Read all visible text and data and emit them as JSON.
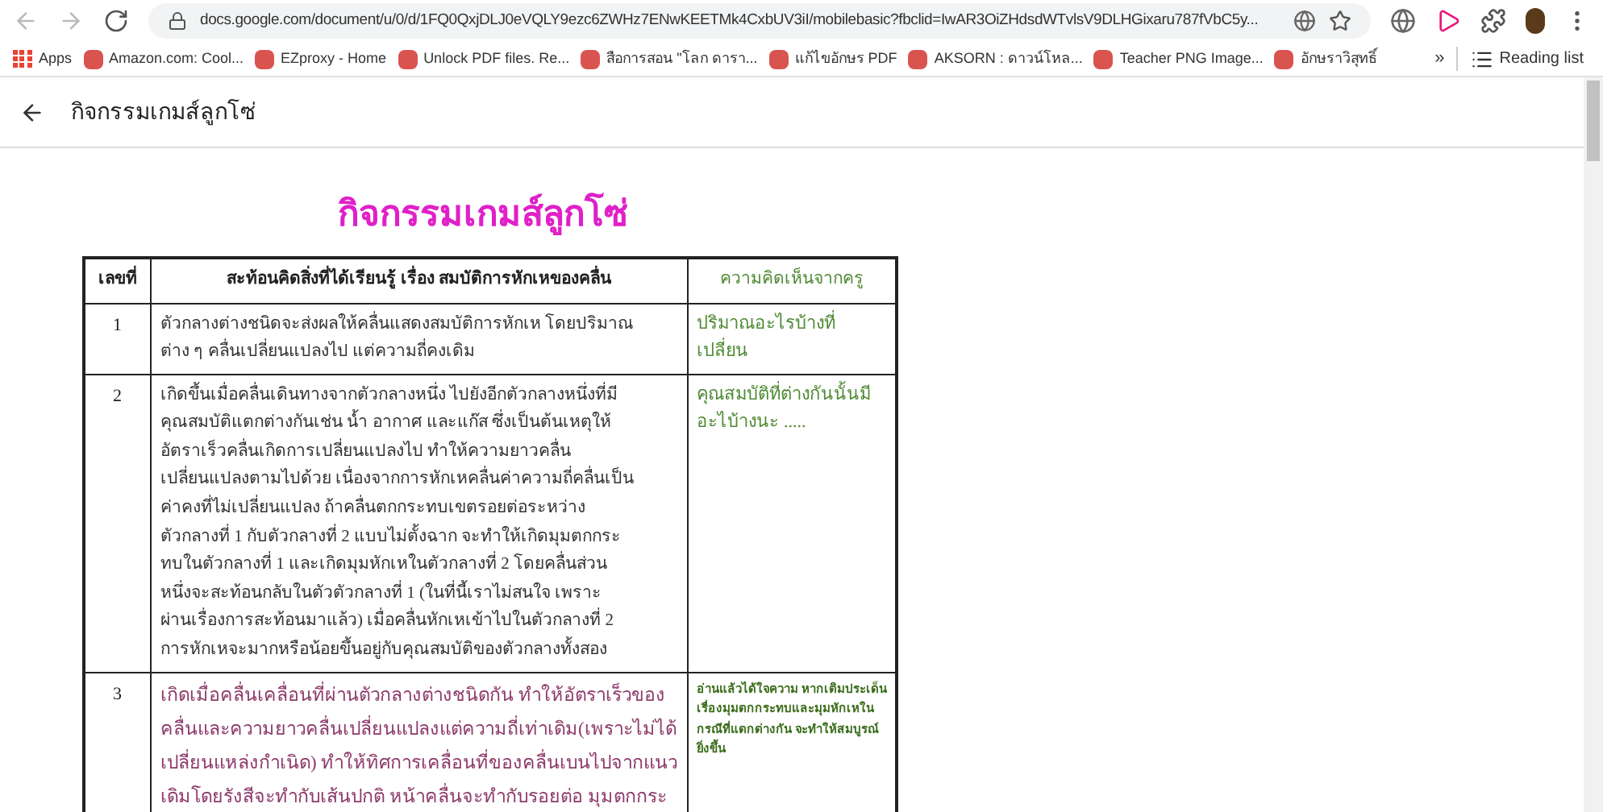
{
  "browser": {
    "url": "docs.google.com/document/u/0/d/1FQ0QxjDLJ0eVQLY9ezc6ZWHz7ENwKEETMk4CxbUV3iI/mobilebasic?fbclid=IwAR3OiZHdsdWTvlsV9DLHGixaru787fVbC5y...",
    "bookmarks": [
      "Apps",
      "Amazon.com: Cool...",
      "EZproxy - Home",
      "Unlock PDF files. Re...",
      "สือการสอน \"โลก ดารา...",
      "แก้ไขอักษร PDF",
      "AKSORN : ดาวน์โหล...",
      "Teacher PNG Image...",
      "อักษราวิสุทธิ์"
    ],
    "overflow": "»",
    "reading_list": "Reading list"
  },
  "doc_header": {
    "title": "กิจกรรมเกมส์ลูกโซ่"
  },
  "document": {
    "heading": "กิจกรรมเกมส์ลูกโซ่",
    "table": {
      "columns": [
        "เลขที่",
        "สะท้อนคิดสิ่งที่ได้เรียนรู้  เรื่อง สมบัติการหักเหของคลื่น",
        "ความคิดเห็นจากครู"
      ],
      "rows": [
        {
          "number": "1",
          "kind": "plain",
          "lines": [
            "ตัวกลางต่างชนิดจะส่งผลให้คลื่นแสดงสมบัติการหักเห โดยปริมาณ",
            "ต่าง ๆ คลื่นเปลี่ยนแปลงไป แต่ความถี่คงเดิม"
          ],
          "comment": {
            "kind": "normal",
            "lines": [
              "ปริมาณอะไรบ้างที่",
              "เปลี่ยน"
            ]
          }
        },
        {
          "number": "2",
          "kind": "plain",
          "lines": [
            "เกิดขึ้นเมื่อคลื่นเดินทางจากตัวกลางหนึ่ง ไปยังอีกตัวกลางหนึ่งที่มี",
            "คุณสมบัติแตกต่างกันเช่น น้ำ อากาศ และแก๊ส ซึ่งเป็นต้นเหตุให้",
            "อัตราเร็วคลื่นเกิดการเปลี่ยนแปลงไป ทำให้ความยาวคลื่น",
            "เปลี่ยนแปลงตามไปด้วย เนื่องจากการหักเหคลื่นค่าความถี่คลื่นเป็น",
            "ค่าคงที่ไม่เปลี่ยนแปลง  ถ้าคลื่นตกกระทบเขตรอยต่อระหว่าง",
            "ตัวกลางที่ 1 กับตัวกลางที่ 2  แบบไม่ตั้งฉาก จะทำให้เกิดมุมตกกระ",
            "ทบในตัวกลางที่ 1 และเกิดมุมหักเหในตัวกลางที่ 2 โดยคลื่นส่วน",
            "หนึ่งจะสะท้อนกลับในตัวตัวกลางที่ 1 (ในที่นี้เราไม่สนใจ เพราะ",
            "ผ่านเรื่องการสะท้อนมาแล้ว)  เมื่อคลื่นหักเหเข้าไปในตัวกลางที่ 2",
            " การหักเหจะมากหรือน้อยขึ้นอยู่กับคุณสมบัติของตัวกลางทั้งสอง"
          ],
          "comment": {
            "kind": "normal",
            "lines": [
              "คุณสมบัติที่ต่างกันนั้นมี",
              "อะไบ้างนะ ....."
            ]
          }
        },
        {
          "number": "3",
          "kind": "revised",
          "lines": [
            "เกิดเมื่อคลื่นเคลื่อนที่ผ่านตัวกลางต่างชนิดกัน ทำให้อัตราเร็วของ",
            "คลื่นและความยาวคลื่นเปลี่ยนแปลงแต่ความถี่เท่าเดิม(เพราะไม่ได้",
            "เปลี่ยนแหล่งกำเนิด) ทำให้ทิศการเคลื่อนที่ของคลื่นเบนไปจากแนว",
            "เดิมโดยรังสีจะทำกับเส้นปกติ หน้าคลื่นจะทำกับรอยต่อ มุมตกกระ"
          ],
          "comment": {
            "kind": "note",
            "lines": [
              "อ่านแล้วได้ใจความ หากเติมประเด็น",
              "เรื่องมุมตกกระทบและมุมหักเหใน",
              "กรณีที่แตกต่างกัน จะทำให้สมบูรณ์",
              "ยิ่งขึ้น"
            ]
          }
        }
      ]
    }
  }
}
